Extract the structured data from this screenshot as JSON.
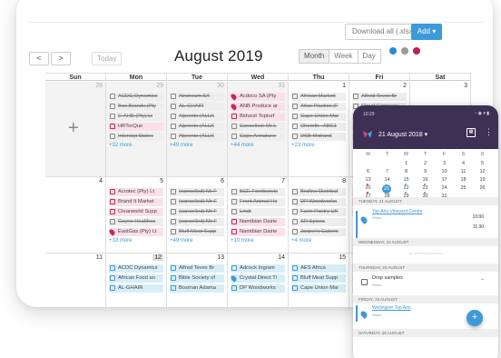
{
  "toolbar": {
    "download_label": "Download all (.xlsx)",
    "add_label": "Add",
    "prev_label": "<",
    "next_label": ">",
    "today_label": "Today",
    "month_title": "August 2019",
    "views": [
      "Month",
      "Week",
      "Day"
    ],
    "active_view": "Month",
    "color_dots": [
      "#2b8ad8",
      "#9a9a9a",
      "#c21c5f"
    ]
  },
  "calendar": {
    "weekdays": [
      "Sun",
      "Mon",
      "Tue",
      "Wed",
      "Thu",
      "Fri",
      "Sat"
    ],
    "weeks": [
      {
        "days": [
          {
            "num": "28",
            "other": true,
            "plus": true,
            "events": [],
            "more": ""
          },
          {
            "num": "29",
            "other": true,
            "events": [
              {
                "t": "ACDC Dynamics",
                "s": "strike"
              },
              {
                "t": "Bos Brands (Pty",
                "s": "strike"
              },
              {
                "t": "E-AHB (Pty) Lt",
                "s": "strike"
              },
              {
                "t": "HRTorQue",
                "s": "pink"
              },
              {
                "t": "Interstat Statev",
                "s": "strike"
              }
            ],
            "more": "+32 more"
          },
          {
            "num": "30",
            "other": true,
            "events": [
              {
                "t": "Airstream SA",
                "s": "strike"
              },
              {
                "t": "AL-GHAIR",
                "s": "strike"
              },
              {
                "t": "Alprents (ALLK",
                "s": "strike"
              },
              {
                "t": "Alprents (ALLK",
                "s": "strike"
              },
              {
                "t": "Alprents (ALLK",
                "s": "strike"
              }
            ],
            "more": "+49 more"
          },
          {
            "num": "31",
            "other": true,
            "events": [
              {
                "t": "Acdoco SA (Pty",
                "s": "pin"
              },
              {
                "t": "ANB Produce ar",
                "s": "pin"
              },
              {
                "t": "Bidvest Topturf",
                "s": "pink"
              },
              {
                "t": "Cancelled: Mr L",
                "s": "strike"
              },
              {
                "t": "Cape Armature:",
                "s": "strike"
              }
            ],
            "more": "+44 more"
          },
          {
            "num": "1",
            "events": [
              {
                "t": "African Marketi",
                "s": "strike"
              },
              {
                "t": "Atlas Plastics (F",
                "s": "strike"
              },
              {
                "t": "Cape Union Mar",
                "s": "strike"
              },
              {
                "t": "Chemfit - ABC1",
                "s": "strike"
              },
              {
                "t": "DSB Midrand",
                "s": "strike"
              }
            ],
            "more": "+23 more"
          },
          {
            "num": "2",
            "events": [
              {
                "t": "Alfred Teves Br",
                "s": "strike"
              },
              {
                "t": "Cloud Company",
                "s": "strike"
              },
              {
                "t": "Consortium Hol",
                "s": "strike"
              },
              {
                "t": "Crystal Direct Tr",
                "s": "strike"
              },
              {
                "t": "Culinary Equipm",
                "s": "strike"
              }
            ],
            "more": "+10 more"
          },
          {
            "num": "3",
            "events": [],
            "more": ""
          }
        ]
      },
      {
        "days": [
          {
            "num": "4",
            "events": [],
            "more": ""
          },
          {
            "num": "5",
            "events": [
              {
                "t": "Acrotec (Pty) Lt",
                "s": "pink"
              },
              {
                "t": "Brand It Market",
                "s": "pink"
              },
              {
                "t": "Clearworld Supp",
                "s": "pink"
              },
              {
                "t": "Coyne Healthca",
                "s": "strike"
              },
              {
                "t": "EastGas (Pty) Lt",
                "s": "pin"
              }
            ],
            "more": "+33 more"
          },
          {
            "num": "6",
            "events": [
              {
                "t": "(cancelled) Mr F",
                "s": "strike"
              },
              {
                "t": "(cancelled) Mr F",
                "s": "strike"
              },
              {
                "t": "(cancelled) Mr F",
                "s": "strike"
              },
              {
                "t": "(cancelled) Mr F",
                "s": "strike"
              },
              {
                "t": "Bluff Meat Supp",
                "s": "strike"
              }
            ],
            "more": "+49 more"
          },
          {
            "num": "7",
            "events": [
              {
                "t": "BCE Foodservic",
                "s": "strike"
              },
              {
                "t": "Front Animal He",
                "s": "strike"
              },
              {
                "t": "Lindt",
                "s": "strike"
              },
              {
                "t": "Namibian Dairie",
                "s": "pink"
              },
              {
                "t": "Namibian Dairie",
                "s": "pink"
              }
            ],
            "more": "+10 more"
          },
          {
            "num": "8",
            "events": [
              {
                "t": "Brafine Distribut",
                "s": "strike"
              },
              {
                "t": "DP Woodworkn",
                "s": "strike"
              },
              {
                "t": "Farm Pantry UK",
                "s": "strike"
              },
              {
                "t": "SR Spices",
                "s": "strike"
              },
              {
                "t": "Jasper's Caterin",
                "s": "strike"
              }
            ],
            "more": "+4 more"
          },
          {
            "num": "9",
            "events": [
              {
                "t": "Inkan Labels",
                "s": "strike"
              },
              {
                "t": "Pura Soda Beve",
                "s": "pink"
              },
              {
                "t": "SWU",
                "s": "strike"
              }
            ],
            "more": ""
          },
          {
            "num": "10",
            "events": [],
            "more": ""
          }
        ]
      },
      {
        "days": [
          {
            "num": "11",
            "events": [],
            "more": ""
          },
          {
            "num": "12",
            "highlight": true,
            "events": [
              {
                "t": "ACDC Dynamics",
                "s": "blue"
              },
              {
                "t": "African Food an",
                "s": "blue"
              },
              {
                "t": "AL-GHAIR",
                "s": "blue"
              }
            ],
            "more": ""
          },
          {
            "num": "13",
            "events": [
              {
                "t": "Alfred Teves Br",
                "s": "blue"
              },
              {
                "t": "Bible Society of",
                "s": "blue"
              },
              {
                "t": "Bosman Adama",
                "s": "blue"
              }
            ],
            "more": ""
          },
          {
            "num": "14",
            "events": [
              {
                "t": "Adcock Ingram",
                "s": "blue"
              },
              {
                "t": "Crystal Direct Ti",
                "s": "bluepin"
              },
              {
                "t": "DP Woodworks",
                "s": "blue"
              }
            ],
            "more": ""
          },
          {
            "num": "15",
            "events": [
              {
                "t": "AES Africa",
                "s": "blue"
              },
              {
                "t": "Bluff Meat Supp",
                "s": "blue"
              },
              {
                "t": "Cape Union Mar",
                "s": "blue"
              }
            ],
            "more": ""
          },
          {
            "num": "16",
            "events": [
              {
                "t": "10X Investment",
                "s": "blue"
              },
              {
                "t": "ADA Agribusine",
                "s": "blue"
              },
              {
                "t": "Adapt IT (eThek",
                "s": "blue"
              }
            ],
            "more": ""
          },
          {
            "num": "17",
            "events": [],
            "more": ""
          }
        ]
      }
    ]
  },
  "phone": {
    "status_time": "10:29",
    "header_date": "21 August 2018",
    "mini_weekdays": [
      "M",
      "T",
      "W",
      "T",
      "F",
      "S",
      "S"
    ],
    "mini_rows": [
      [
        "",
        "",
        "1",
        "2",
        "3",
        "4",
        "5"
      ],
      [
        "6",
        "7",
        "8",
        "9",
        "10",
        "11",
        "12"
      ],
      [
        "13",
        "14",
        "15",
        "16",
        "17",
        "18",
        "19"
      ],
      [
        "20",
        "21",
        "22",
        "23",
        "24",
        "25",
        "26"
      ],
      [
        "27",
        "28",
        "29",
        "30",
        "31",
        "",
        ""
      ]
    ],
    "selected_day": "21",
    "agenda": {
      "tue_head": "TUESDAY, 21 AUGUST",
      "tue_title": "Top Arts Vineyard Centre",
      "tue_sub": "Stone",
      "tue_time_start": "10:00",
      "tue_time_end": "11:30",
      "wed_head": "WEDNESDAY, 22 AUGUST",
      "wed_empty": "No events scheduled",
      "thu_head": "THURSDAY, 23 AUGUST",
      "thu_title": "Drop samples",
      "thu_sub": "Stone",
      "thu_time": "–",
      "fri_head": "FRIDAY, 24 AUGUST",
      "fri_title": "Wellington Top Arts",
      "fri_sub": "Stone",
      "sat_head": "SATURDAY, 25 AUGUST"
    },
    "fab_label": "+"
  }
}
